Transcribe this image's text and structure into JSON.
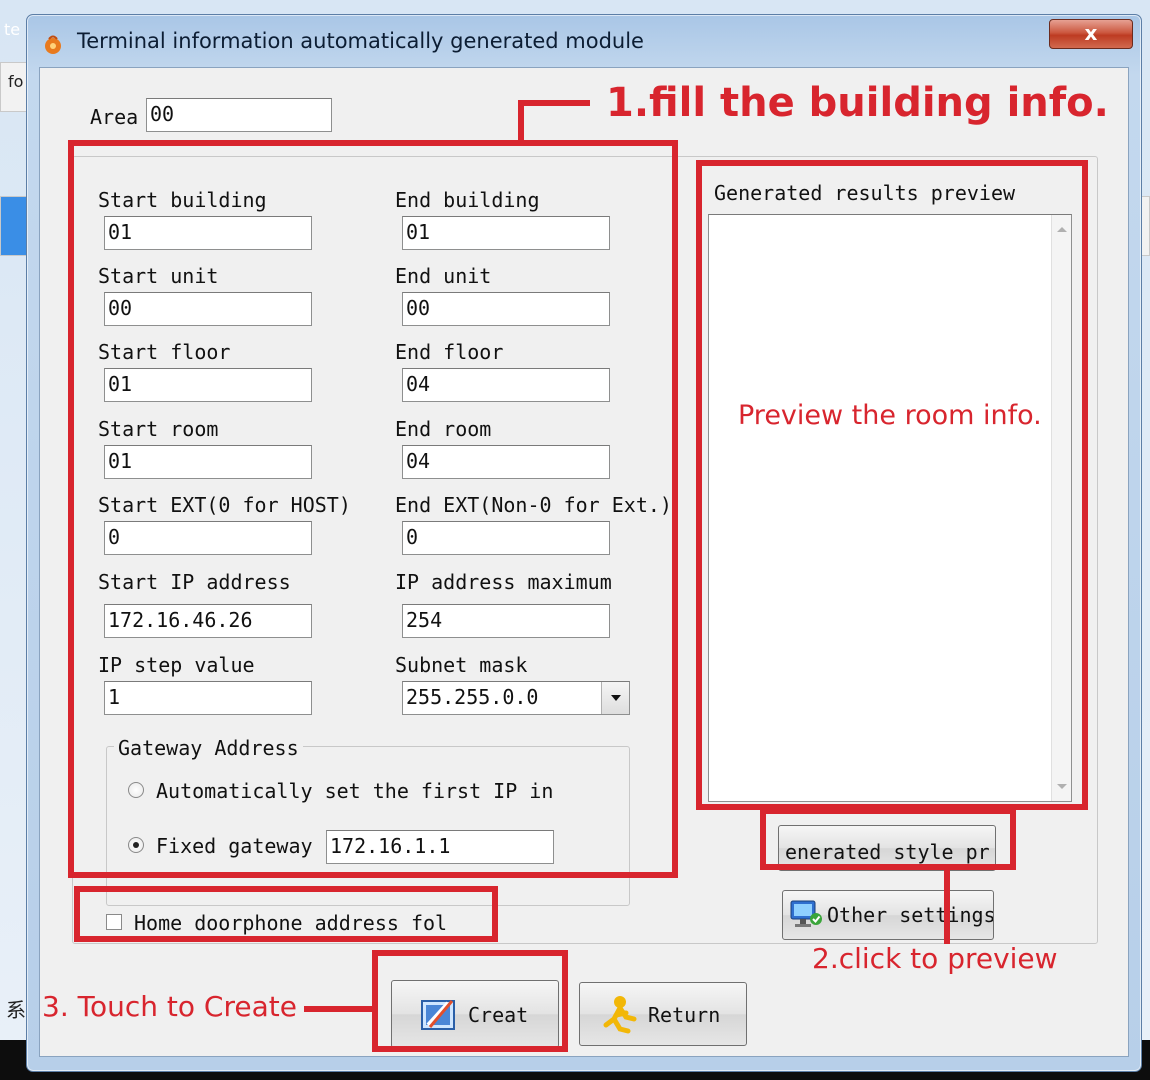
{
  "window": {
    "title": "Terminal information automatically generated module",
    "close_label": "x"
  },
  "area": {
    "label": "Area",
    "value": "00"
  },
  "building_info": {
    "start_building": {
      "label": "Start building",
      "value": "01"
    },
    "end_building": {
      "label": "End building",
      "value": "01"
    },
    "start_unit": {
      "label": "Start unit",
      "value": "00"
    },
    "end_unit": {
      "label": "End unit",
      "value": "00"
    },
    "start_floor": {
      "label": "Start floor",
      "value": "01"
    },
    "end_floor": {
      "label": "End floor",
      "value": "04"
    },
    "start_room": {
      "label": "Start room",
      "value": "01"
    },
    "end_room": {
      "label": "End room",
      "value": "04"
    },
    "start_ext": {
      "label": "Start EXT(0 for HOST)",
      "value": "0"
    },
    "end_ext": {
      "label": "End EXT(Non-0 for Ext.)",
      "value": "0"
    },
    "start_ip": {
      "label": "Start IP address",
      "value": "172.16.46.26"
    },
    "ip_max": {
      "label": "IP address maximum",
      "value": "254"
    },
    "ip_step": {
      "label": "IP step value",
      "value": "1"
    },
    "subnet_mask": {
      "label": "Subnet mask",
      "value": "255.255.0.0"
    }
  },
  "gateway": {
    "title": "Gateway Address",
    "auto_label": "Automatically set the first IP in",
    "fixed_label": "Fixed gateway",
    "fixed_value": "172.16.1.1",
    "selected": "fixed"
  },
  "home_doorphone": {
    "label": "Home doorphone address fol",
    "checked": false
  },
  "preview": {
    "title": "Generated results preview",
    "content": ""
  },
  "buttons": {
    "generated_style": "enerated style pr",
    "other_settings": "Other settings",
    "create": "Creat",
    "return": "Return"
  },
  "annotations": {
    "step1": "1.fill the building info.",
    "preview_note": "Preview the room info.",
    "step2": "2.click to preview",
    "step3": "3. Touch to Create"
  },
  "background": {
    "edge_text_1": "te",
    "edge_text_2": "fo",
    "edge_text_3": "系"
  },
  "colors": {
    "annotation_red": "#d8252e",
    "title_bar": "#b7cfe9",
    "dialog_bg": "#f0f0f0"
  }
}
